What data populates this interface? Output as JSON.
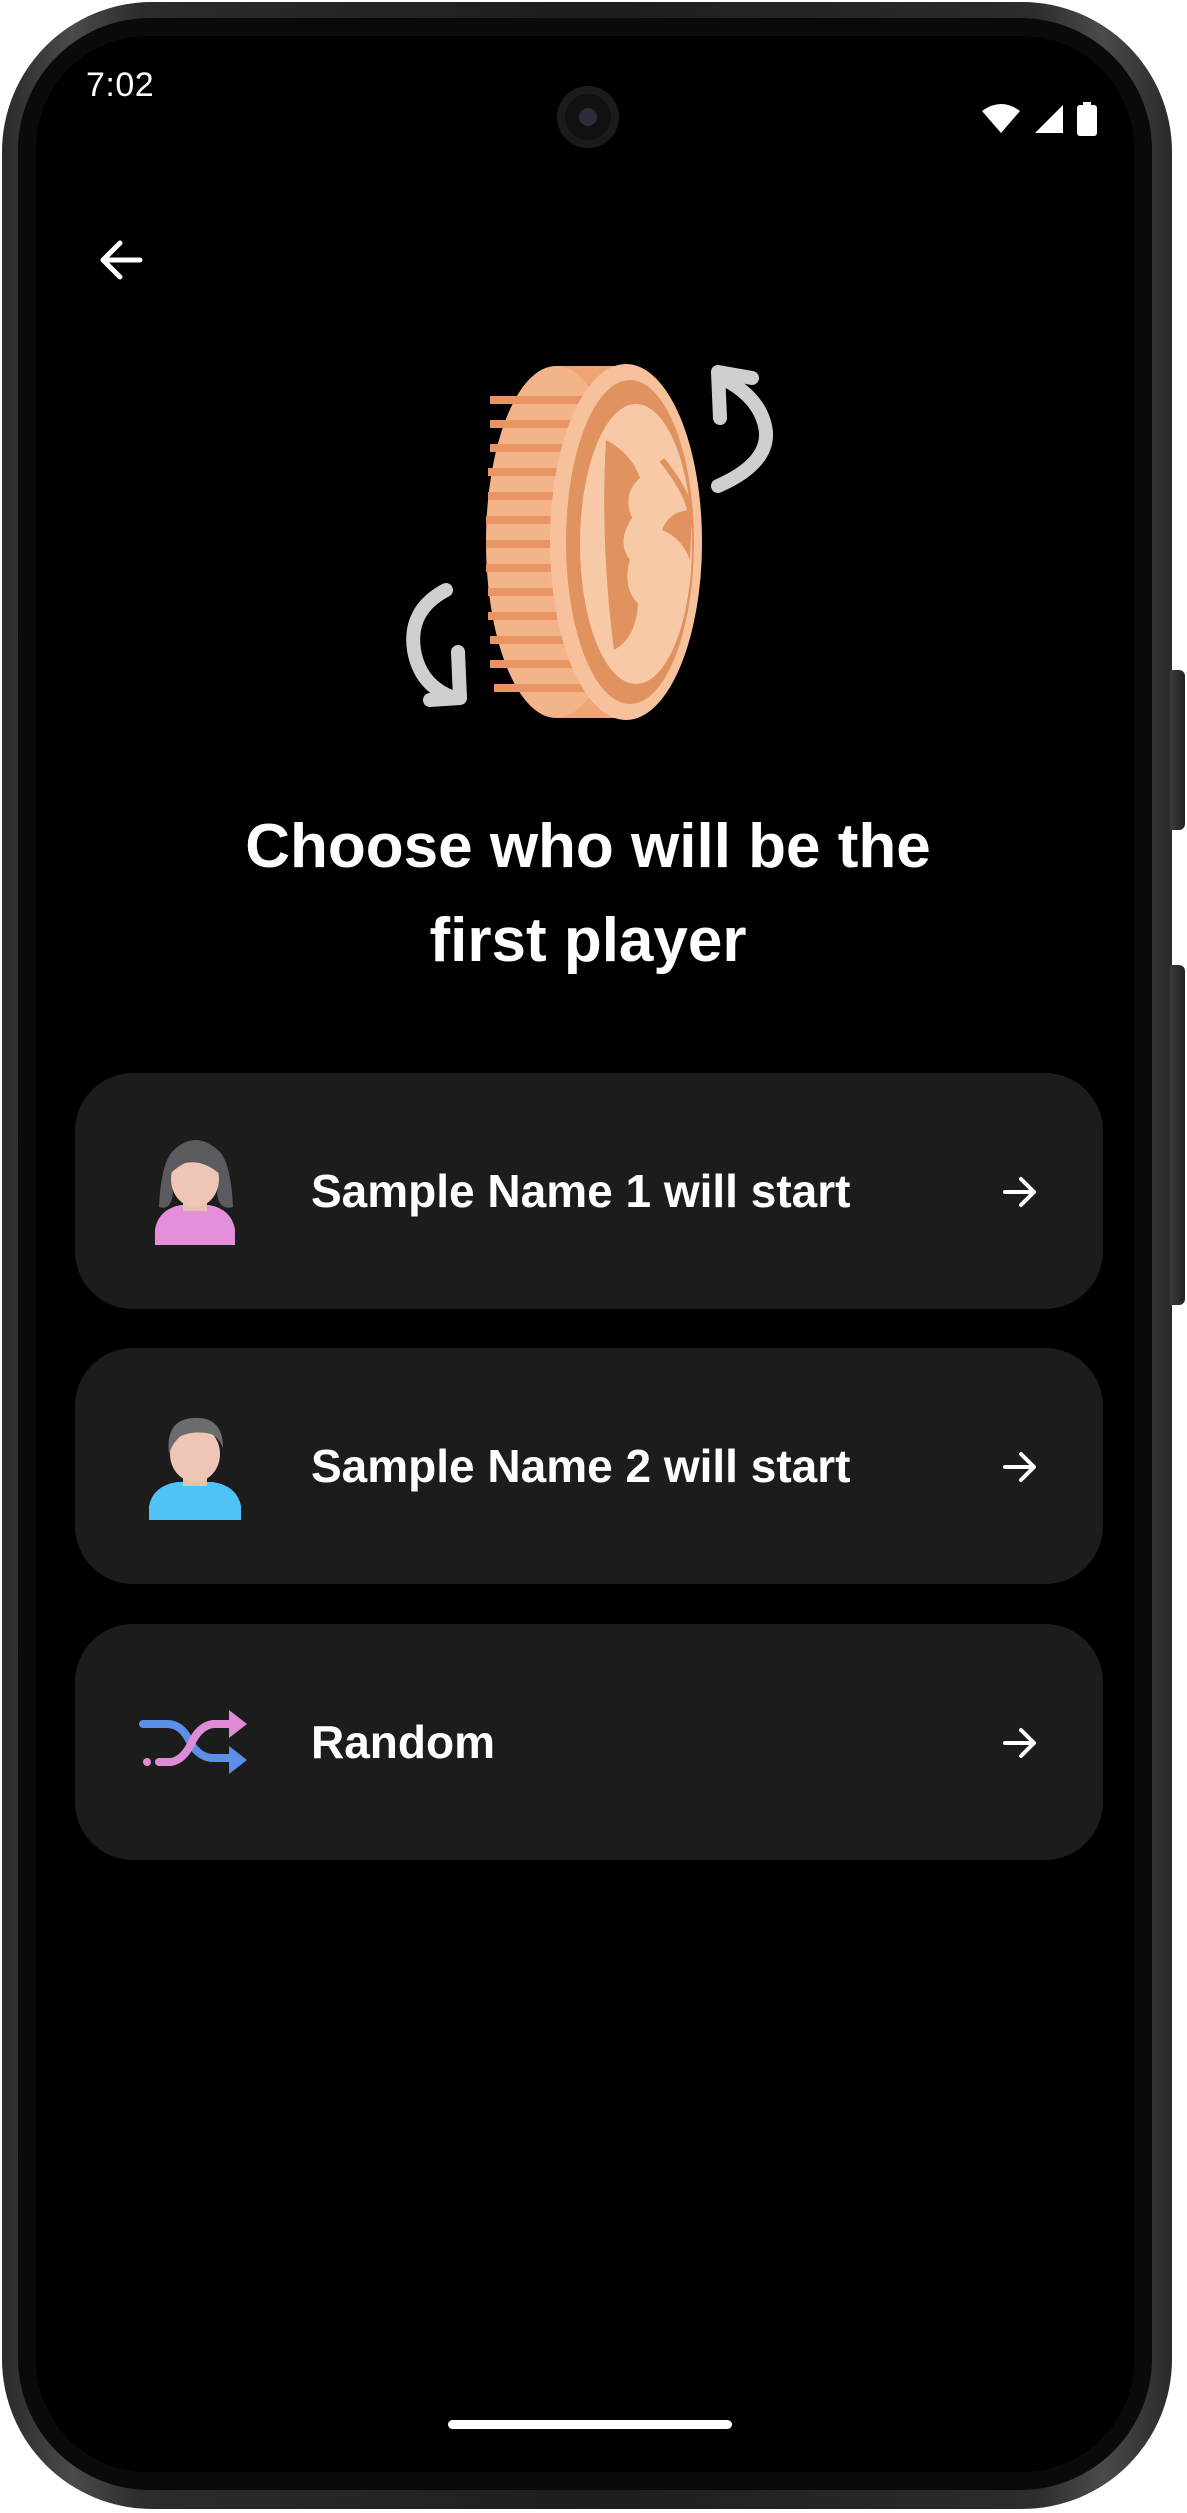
{
  "status_bar": {
    "time": "7:02"
  },
  "header": {
    "back_icon": "arrow-back-icon"
  },
  "hero": {
    "illustration": "coin-flip-icon"
  },
  "title": {
    "line1": "Choose who will be the",
    "line2": "first player"
  },
  "options": [
    {
      "label": "Sample Name 1 will start",
      "icon": "female-avatar-icon",
      "accent": "#e38fdc"
    },
    {
      "label": "Sample Name 2 will start",
      "icon": "male-avatar-icon",
      "accent": "#4fc3f7"
    },
    {
      "label": "Random",
      "icon": "shuffle-icon",
      "accent": "#e08bd8"
    }
  ],
  "colors": {
    "background": "#000000",
    "card": "#1c1c1c",
    "text": "#ffffff",
    "coin_face": "#e0925f",
    "coin_edge": "#f3b48a"
  }
}
